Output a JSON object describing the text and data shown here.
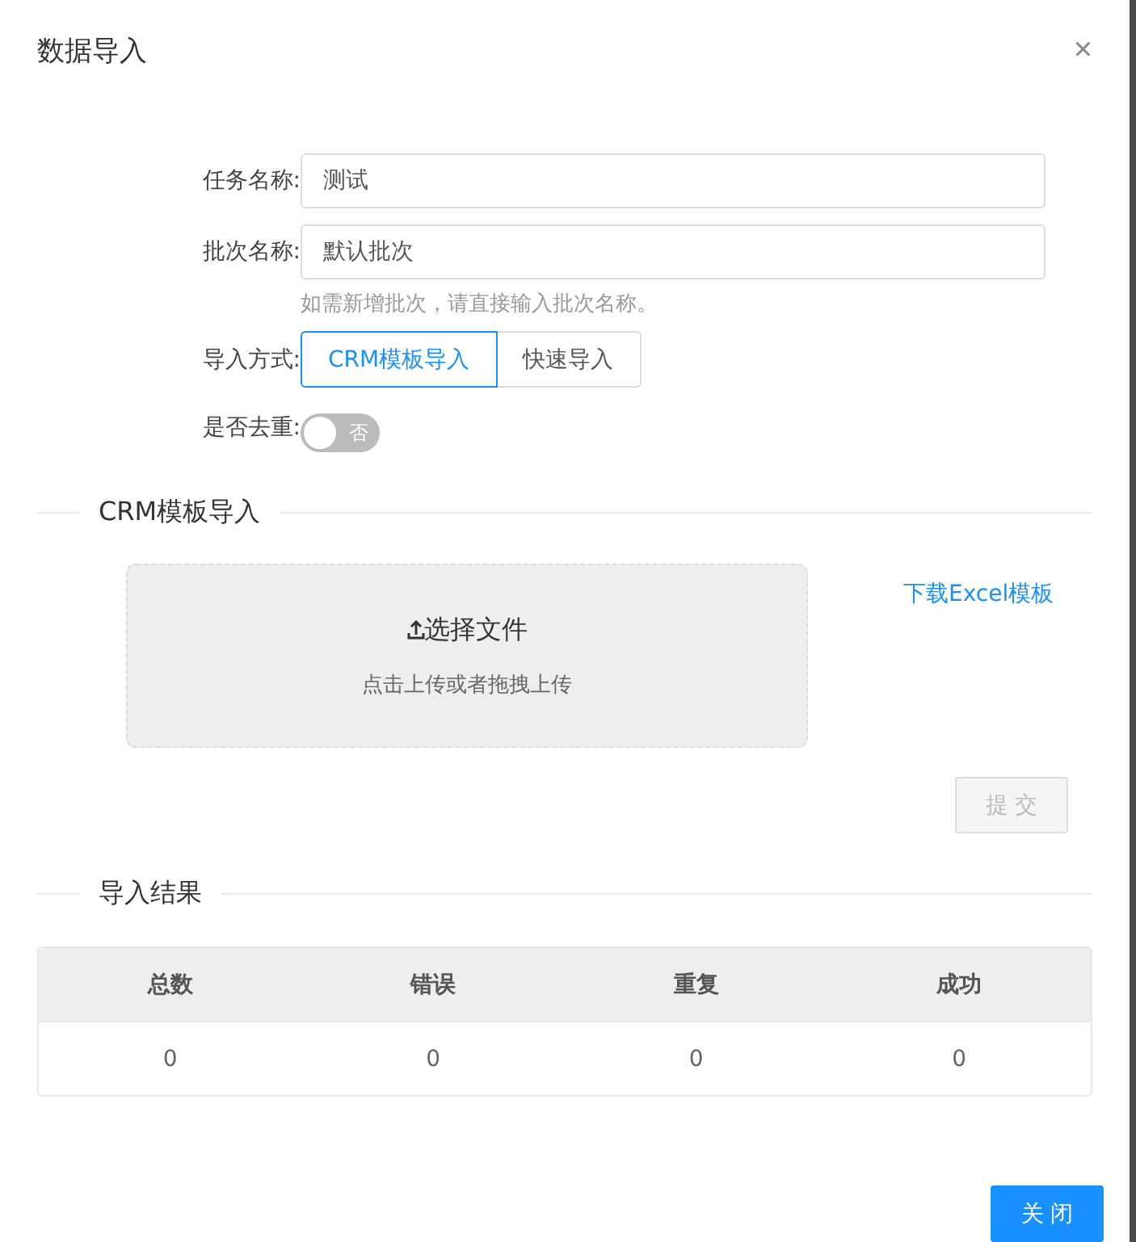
{
  "dialog": {
    "title": "数据导入",
    "close_icon": "×"
  },
  "form": {
    "task_name": {
      "label": "任务名称:",
      "value": "测试"
    },
    "batch_name": {
      "label": "批次名称:",
      "value": "默认批次",
      "hint": "如需新增批次，请直接输入批次名称。"
    },
    "import_mode": {
      "label": "导入方式:",
      "options": [
        {
          "label": "CRM模板导入",
          "selected": true
        },
        {
          "label": "快速导入",
          "selected": false
        }
      ]
    },
    "dedupe": {
      "label": "是否去重:",
      "on": false,
      "text": "否"
    }
  },
  "upload_section": {
    "title": "CRM模板导入",
    "upload_button": "选择文件",
    "upload_hint": "点击上传或者拖拽上传",
    "template_link": "下载Excel模板",
    "submit_button": {
      "label": "提 交",
      "disabled": true
    }
  },
  "result_section": {
    "title": "导入结果",
    "table": {
      "columns": [
        "总数",
        "错误",
        "重复",
        "成功"
      ],
      "rows": [
        [
          "0",
          "0",
          "0",
          "0"
        ]
      ]
    }
  },
  "footer": {
    "close_button": "关 闭"
  }
}
